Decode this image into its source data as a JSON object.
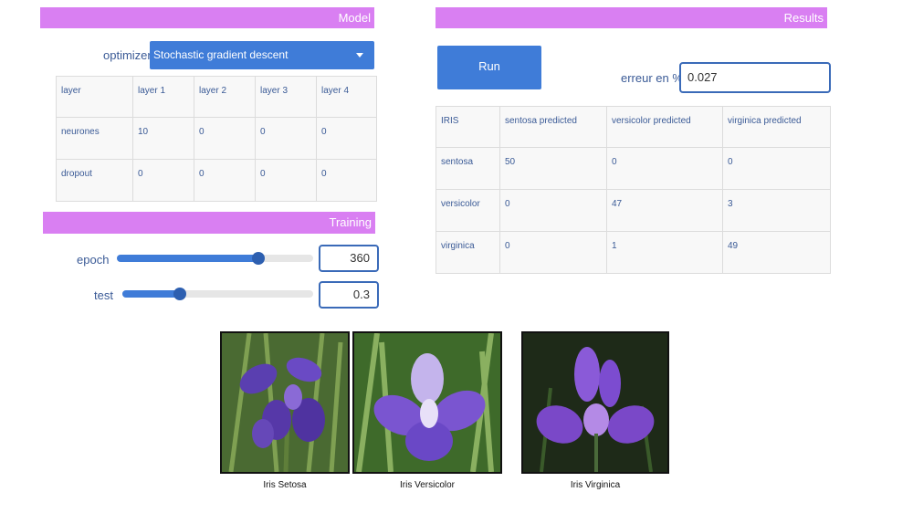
{
  "model": {
    "header": "Model",
    "optimizer_label": "optimizer",
    "optimizer_value": "Stochastic gradient descent",
    "table": {
      "rows": [
        [
          "layer",
          "layer 1",
          "layer 2",
          "layer 3",
          "layer 4"
        ],
        [
          "neurones",
          "10",
          "0",
          "0",
          "0"
        ],
        [
          "dropout",
          "0",
          "0",
          "0",
          "0"
        ]
      ]
    }
  },
  "training": {
    "header": "Training",
    "epoch": {
      "label": "epoch",
      "value": "360",
      "fraction": 0.72
    },
    "test": {
      "label": "test",
      "value": "0.3",
      "fraction": 0.3
    }
  },
  "results": {
    "header": "Results",
    "run_label": "Run",
    "erreur_label": "erreur en %",
    "erreur_value": "0.027",
    "table": {
      "rows": [
        [
          "IRIS",
          "sentosa predicted",
          "versicolor predicted",
          "virginica predicted"
        ],
        [
          "sentosa",
          "50",
          "0",
          "0"
        ],
        [
          "versicolor",
          "0",
          "47",
          "3"
        ],
        [
          "virginica",
          "0",
          "1",
          "49"
        ]
      ]
    }
  },
  "images": [
    {
      "caption": "Iris Setosa"
    },
    {
      "caption": "Iris Versicolor"
    },
    {
      "caption": "Iris Virginica"
    }
  ],
  "colors": {
    "section_header": "#d97ff2",
    "primary": "#3f7cd8",
    "text": "#3a5a96"
  }
}
